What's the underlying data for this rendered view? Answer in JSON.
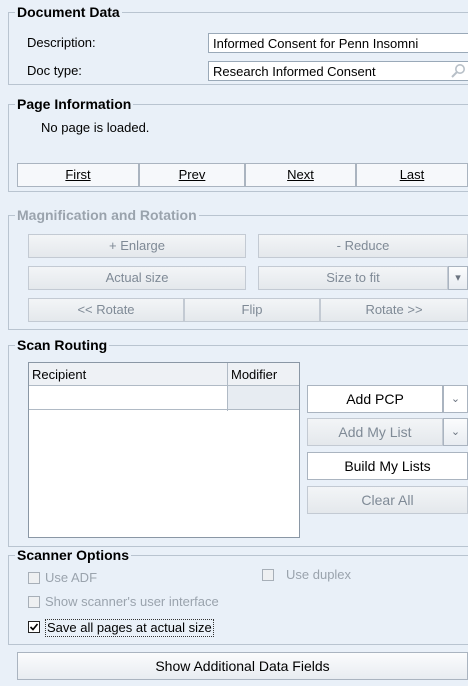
{
  "document_data": {
    "title": "Document Data",
    "description_label": "Description:",
    "description_value": "Informed Consent for Penn Insomni",
    "doctype_label": "Doc type:",
    "doctype_value": "Research Informed Consent"
  },
  "page_info": {
    "title": "Page Information",
    "status": "No page is loaded.",
    "first_label": "First",
    "prev_label": "Prev",
    "next_label": "Next",
    "last_label": "Last"
  },
  "magnification": {
    "title": "Magnification and Rotation",
    "enlarge_label": "+ Enlarge",
    "reduce_label": "- Reduce",
    "actual_size_label": "Actual size",
    "size_to_fit_label": "Size to fit",
    "rotate_left_label": "<< Rotate",
    "flip_label": "Flip",
    "rotate_right_label": "Rotate >>"
  },
  "scan_routing": {
    "title": "Scan Routing",
    "columns": [
      "Recipient",
      "Modifier"
    ],
    "add_pcp_label": "Add PCP",
    "add_my_list_label": "Add My List",
    "build_my_lists_label": "Build My Lists",
    "clear_all_label": "Clear All"
  },
  "scanner_options": {
    "title": "Scanner Options",
    "use_adf_label": "Use ADF",
    "use_duplex_label": "Use duplex",
    "show_ui_label": "Show scanner's user interface",
    "save_actual_label": "Save all pages at actual size",
    "use_adf_checked": false,
    "use_duplex_checked": false,
    "show_ui_checked": false,
    "save_actual_checked": true
  },
  "footer": {
    "show_fields_label": "Show Additional Data Fields"
  },
  "icons": {
    "lookup": "magnifier-icon",
    "dropdown": "chevron-down-icon",
    "checkmark": "checkmark-icon"
  },
  "colors": {
    "panel_bg": "#e9f0f8",
    "disabled_text": "#9aa3ad",
    "border": "#b9c4d0"
  }
}
